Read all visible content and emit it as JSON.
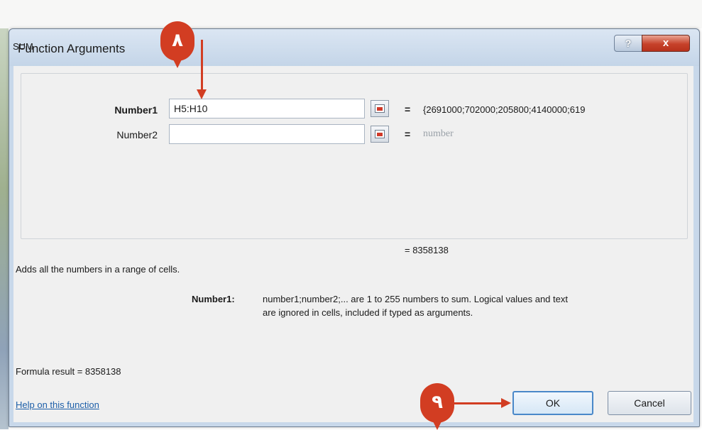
{
  "dialog": {
    "title": "Function Arguments",
    "help_glyph": "?",
    "close_glyph": "x",
    "function_name": "SUM"
  },
  "arguments": [
    {
      "label": "Number1",
      "value": "H5:H10",
      "result": "{2691000;702000;205800;4140000;619"
    },
    {
      "label": "Number2",
      "value": "",
      "result": "number"
    }
  ],
  "equals_sign": "=",
  "overall_result": "= 8358138",
  "function_description": "Adds all the numbers in a range of cells.",
  "argument_help": {
    "label": "Number1:",
    "text_line1": "number1;number2;... are 1 to 255 numbers to sum. Logical values and text",
    "text_line2": "are ignored in cells, included if typed as arguments."
  },
  "formula_result": "Formula result =  8358138",
  "help_link": "Help on this function",
  "buttons": {
    "ok": "OK",
    "cancel": "Cancel"
  },
  "annotations": {
    "marker_8": "٨",
    "marker_9": "٩"
  },
  "colors": {
    "annotation": "#d23d22",
    "link": "#1c5ea8",
    "ok_border": "#4a88c9"
  }
}
